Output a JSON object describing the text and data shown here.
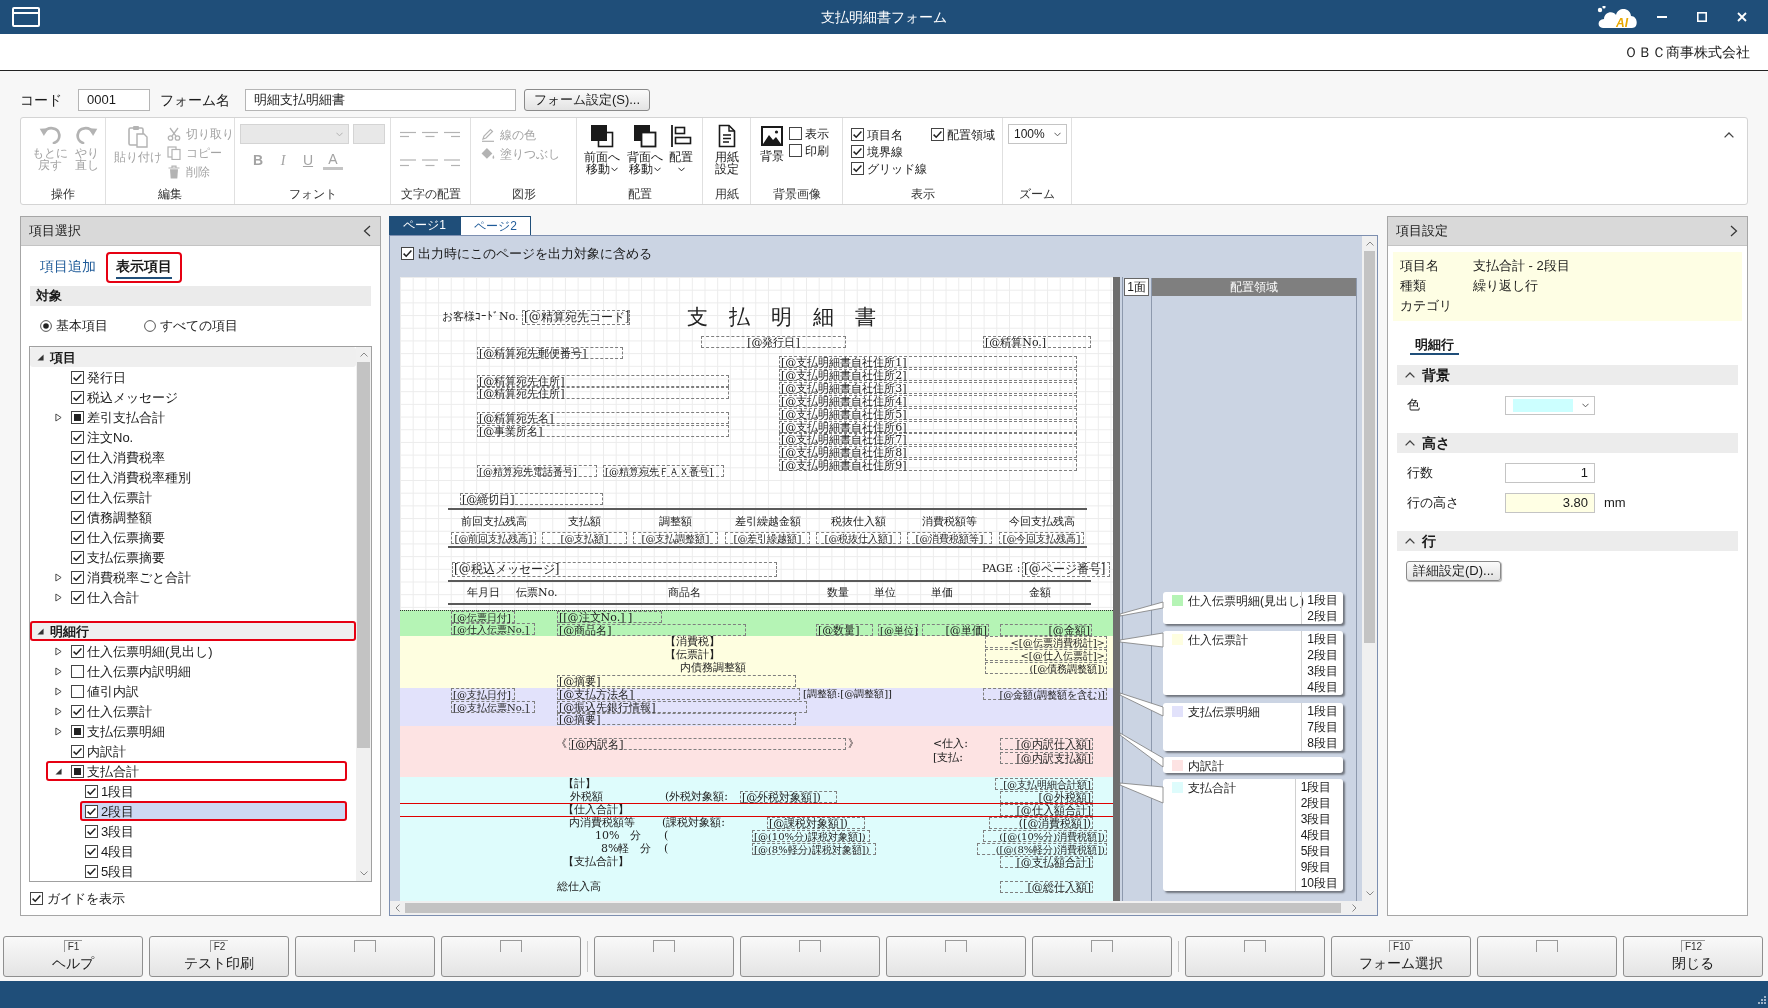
{
  "window": {
    "title": "支払明細書フォーム",
    "assistant_label": "AI"
  },
  "company": "ＯＢＣ商事株式会社",
  "form_header": {
    "code_label": "コード",
    "code": "0001",
    "name_label": "フォーム名",
    "name": "明細支払明細書",
    "settings_button": "フォーム設定(S)..."
  },
  "ribbon": {
    "groups": [
      {
        "label": "操作",
        "items": [
          {
            "kind": "large",
            "label": "もとに戻す",
            "menu": false,
            "disabled": true
          },
          {
            "kind": "large",
            "label": "やり直し",
            "menu": false,
            "disabled": true
          }
        ]
      },
      {
        "label": "編集",
        "items": [
          {
            "kind": "large",
            "label": "貼り付け",
            "menu": false,
            "disabled": true
          },
          {
            "kind": "small",
            "label": "切り取り",
            "disabled": true
          },
          {
            "kind": "small",
            "label": "コピー",
            "disabled": true
          },
          {
            "kind": "small",
            "label": "削除",
            "disabled": true
          }
        ]
      },
      {
        "label": "フォント",
        "items": [
          {
            "kind": "select",
            "disabled": true
          },
          {
            "kind": "field",
            "disabled": true
          },
          {
            "kind": "format",
            "label": "B",
            "disabled": true
          },
          {
            "kind": "format",
            "label": "I",
            "disabled": true
          },
          {
            "kind": "format",
            "label": "U",
            "disabled": true
          },
          {
            "kind": "format",
            "label": "A",
            "disabled": true
          }
        ]
      },
      {
        "label": "文字の配置",
        "items": [
          {
            "kind": "align",
            "disabled": true
          },
          {
            "kind": "align",
            "disabled": true
          },
          {
            "kind": "align",
            "disabled": true
          },
          {
            "kind": "align",
            "disabled": true
          },
          {
            "kind": "align",
            "disabled": true
          },
          {
            "kind": "align",
            "disabled": true
          }
        ]
      },
      {
        "label": "図形",
        "items": [
          {
            "kind": "small",
            "label": "線の色",
            "disabled": true
          },
          {
            "kind": "small",
            "label": "塗りつぶし",
            "disabled": true
          }
        ]
      },
      {
        "label": "配置",
        "items": [
          {
            "kind": "large",
            "label": "前面へ移動",
            "menu": true,
            "disabled": false
          },
          {
            "kind": "large",
            "label": "背面へ移動",
            "menu": true,
            "disabled": false
          },
          {
            "kind": "large",
            "label": "配置",
            "menu": true,
            "disabled": false
          }
        ]
      },
      {
        "label": "用紙",
        "items": [
          {
            "kind": "large",
            "label": "用紙設定",
            "menu": false,
            "disabled": false
          }
        ]
      },
      {
        "label": "背景画像",
        "items": [
          {
            "kind": "large",
            "label": "背景",
            "menu": false,
            "disabled": false
          },
          {
            "kind": "check",
            "label": "表示",
            "checked": false
          },
          {
            "kind": "check",
            "label": "印刷",
            "checked": false
          }
        ]
      },
      {
        "label": "表示",
        "items": [
          {
            "kind": "check",
            "label": "項目名",
            "checked": true
          },
          {
            "kind": "check",
            "label": "境界線",
            "checked": true
          },
          {
            "kind": "check",
            "label": "グリッド線",
            "checked": true
          },
          {
            "kind": "check",
            "label": "配置領域",
            "checked": true
          }
        ]
      },
      {
        "label": "ズーム",
        "items": [
          {
            "kind": "select",
            "value": "100%",
            "disabled": false
          }
        ]
      }
    ]
  },
  "item_panel": {
    "title": "項目選択",
    "tabs": [
      {
        "label": "項目追加",
        "selected": false,
        "annotated": false
      },
      {
        "label": "表示項目",
        "selected": true,
        "annotated": true
      }
    ],
    "target": {
      "heading": "対象",
      "options": [
        {
          "label": "基本項目",
          "selected": true
        },
        {
          "label": "すべての項目",
          "selected": false
        }
      ]
    },
    "tree": [
      {
        "label": "項目",
        "expanded": true,
        "selected": false,
        "annotated": false,
        "children": [
          {
            "label": "発行日",
            "checked": true,
            "indeterminate": false,
            "selected": false,
            "annotated": false
          },
          {
            "label": "税込メッセージ",
            "checked": true,
            "indeterminate": false,
            "selected": false,
            "annotated": false
          },
          {
            "label": "差引支払合計",
            "indeterminate": true,
            "expanded": false,
            "selected": false,
            "annotated": false
          },
          {
            "label": "注文No.",
            "checked": true,
            "indeterminate": false,
            "selected": false,
            "annotated": false
          },
          {
            "label": "仕入消費税率",
            "checked": true,
            "indeterminate": false,
            "selected": false,
            "annotated": false
          },
          {
            "label": "仕入消費税率種別",
            "checked": true,
            "indeterminate": false,
            "selected": false,
            "annotated": false
          },
          {
            "label": "仕入伝票計",
            "checked": true,
            "indeterminate": false,
            "selected": false,
            "annotated": false
          },
          {
            "label": "債務調整額",
            "checked": true,
            "indeterminate": false,
            "selected": false,
            "annotated": false
          },
          {
            "label": "仕入伝票摘要",
            "checked": true,
            "indeterminate": false,
            "selected": false,
            "annotated": false
          },
          {
            "label": "支払伝票摘要",
            "checked": true,
            "indeterminate": false,
            "selected": false,
            "annotated": false
          },
          {
            "label": "消費税率ごと合計",
            "checked": true,
            "indeterminate": false,
            "expanded": false,
            "selected": false,
            "annotated": false
          },
          {
            "label": "仕入合計",
            "checked": true,
            "indeterminate": false,
            "expanded": false,
            "selected": false,
            "annotated": false
          }
        ]
      },
      {
        "label": "明細行",
        "expanded": true,
        "selected": false,
        "annotated": true,
        "children": [
          {
            "label": "仕入伝票明細(見出し)",
            "checked": true,
            "indeterminate": false,
            "expanded": false,
            "selected": false,
            "annotated": false
          },
          {
            "label": "仕入伝票内訳明細",
            "checked": false,
            "indeterminate": false,
            "expanded": false,
            "selected": false,
            "annotated": false
          },
          {
            "label": "値引内訳",
            "checked": false,
            "indeterminate": false,
            "expanded": false,
            "selected": false,
            "annotated": false
          },
          {
            "label": "仕入伝票計",
            "checked": true,
            "indeterminate": false,
            "expanded": false,
            "selected": false,
            "annotated": false
          },
          {
            "label": "支払伝票明細",
            "indeterminate": true,
            "expanded": false,
            "selected": false,
            "annotated": false
          },
          {
            "label": "内訳計",
            "checked": true,
            "indeterminate": false,
            "selected": false,
            "annotated": false
          },
          {
            "label": "支払合計",
            "indeterminate": true,
            "expanded": true,
            "selected": false,
            "annotated": true,
            "children": [
              {
                "label": "1段目",
                "checked": true,
                "indeterminate": false,
                "selected": false,
                "annotated": false
              },
              {
                "label": "2段目",
                "checked": true,
                "indeterminate": false,
                "selected": true,
                "annotated": true
              },
              {
                "label": "3段目",
                "checked": true,
                "indeterminate": false,
                "selected": false,
                "annotated": false
              },
              {
                "label": "4段目",
                "checked": true,
                "indeterminate": false,
                "selected": false,
                "annotated": false
              },
              {
                "label": "5段目",
                "checked": true,
                "indeterminate": false,
                "selected": false,
                "annotated": false
              }
            ]
          }
        ]
      }
    ],
    "show_guide": {
      "label": "ガイドを表示",
      "checked": true
    }
  },
  "designer": {
    "tabs": [
      {
        "label": "ページ1",
        "selected": true
      },
      {
        "label": "ページ2",
        "selected": false
      }
    ],
    "include_page": {
      "label": "出力時にこのページを出力対象に含める",
      "checked": true
    },
    "paper": {
      "title": "支　払　明　細　書",
      "header": [
        {
          "kind": "label",
          "text": "お客様ｺｰﾄﾞNo."
        },
        {
          "kind": "field",
          "text": "[@精算宛先コード]"
        },
        {
          "kind": "field",
          "text": "[@発行日]"
        },
        {
          "kind": "field",
          "text": "[@精算No.]"
        },
        {
          "kind": "field",
          "text": "[@精算宛先郵便番号]"
        },
        {
          "kind": "field",
          "text": "[@精算宛先住所]"
        },
        {
          "kind": "field",
          "text": "[@精算宛先住所]"
        },
        {
          "kind": "field",
          "text": "[@精算宛先名]"
        },
        {
          "kind": "field",
          "text": "[@事業所名]"
        },
        {
          "kind": "field",
          "text": "[@精算宛先電話番号]"
        },
        {
          "kind": "field",
          "text": "[@精算宛先ＦＡＸ番号]"
        },
        {
          "kind": "field",
          "text": "[@支払明細書自社住所1]"
        },
        {
          "kind": "field",
          "text": "[@支払明細書自社住所2]"
        },
        {
          "kind": "field",
          "text": "[@支払明細書自社住所3]"
        },
        {
          "kind": "field",
          "text": "[@支払明細書自社住所4]"
        },
        {
          "kind": "field",
          "text": "[@支払明細書自社住所5]"
        },
        {
          "kind": "field",
          "text": "[@支払明細書自社住所6]"
        },
        {
          "kind": "field",
          "text": "[@支払明細書自社住所7]"
        },
        {
          "kind": "field",
          "text": "[@支払明細書自社住所8]"
        },
        {
          "kind": "field",
          "text": "[@支払明細書自社住所9]"
        },
        {
          "kind": "field",
          "text": "[@締切日]"
        },
        {
          "kind": "field",
          "text": "[@税込メッセージ]"
        },
        {
          "kind": "label",
          "text": "PAGE :"
        },
        {
          "kind": "field",
          "text": "[@ページ番号]"
        }
      ],
      "summary": [
        {
          "label": "前回支払残高",
          "value": "[@前回支払残高]"
        },
        {
          "label": "支払額",
          "value": "[@支払額]"
        },
        {
          "label": "調整額",
          "value": "[@支払調整額]"
        },
        {
          "label": "差引繰越金額",
          "value": "[@差引繰越額]"
        },
        {
          "label": "税抜仕入額",
          "value": "[@税抜仕入額]"
        },
        {
          "label": "消費税額等",
          "value": "[@消費税額等]"
        },
        {
          "label": "今回支払残高",
          "value": "[@今回支払残高]"
        }
      ],
      "columns": [
        "年月日",
        "伝票No.",
        "商品名",
        "数量",
        "単位",
        "単価",
        "金額"
      ],
      "bands": [
        {
          "color": "#b5f4b5",
          "fields": [
            {
              "kind": "field",
              "text": "[@伝票日付]"
            },
            {
              "kind": "field",
              "text": "[[@注文No.] ]"
            },
            {
              "kind": "field",
              "text": "[@仕入伝票No.]"
            },
            {
              "kind": "field",
              "text": "[@商品名]"
            },
            {
              "kind": "field",
              "text": "[@数量]"
            },
            {
              "kind": "field",
              "text": "[@単位]"
            },
            {
              "kind": "field",
              "text": "[@単価]"
            },
            {
              "kind": "field",
              "text": "[@金額]"
            }
          ]
        },
        {
          "color": "#fefee0",
          "fields": [
            {
              "kind": "label",
              "text": "【消費税】"
            },
            {
              "kind": "label",
              "text": "【伝票計】"
            },
            {
              "kind": "label",
              "text": "内債務調整額"
            },
            {
              "kind": "field",
              "text": "<[@伝票消費税計]>"
            },
            {
              "kind": "field",
              "text": "<[@仕入伝票計]>"
            },
            {
              "kind": "field",
              "text": "([@債務調整額])"
            },
            {
              "kind": "field",
              "text": "[@摘要]"
            }
          ]
        },
        {
          "color": "#e2e2fb",
          "fields": [
            {
              "kind": "field",
              "text": "[@支払日付]"
            },
            {
              "kind": "field",
              "text": "[@支払伝票No.]"
            },
            {
              "kind": "field",
              "text": "[@支払方法名]"
            },
            {
              "kind": "label",
              "text": "[調整額:[@調整額]]"
            },
            {
              "kind": "field",
              "text": "[@金額(調整額を含む)]"
            },
            {
              "kind": "field",
              "text": "[@振込先銀行情報]"
            },
            {
              "kind": "field",
              "text": "[@摘要]"
            }
          ]
        },
        {
          "color": "#fde3e3",
          "fields": [
            {
              "kind": "label",
              "text": "《"
            },
            {
              "kind": "field",
              "text": "[@内訳名]"
            },
            {
              "kind": "label",
              "text": "》"
            },
            {
              "kind": "label",
              "text": "<仕入:"
            },
            {
              "kind": "field",
              "text": "[@内訳仕入額]"
            },
            {
              "kind": "label",
              "text": "[支払:"
            },
            {
              "kind": "field",
              "text": "[@内訳支払額]"
            }
          ]
        },
        {
          "color": "#defcfc",
          "fields": [
            {
              "kind": "label",
              "text": "【計】"
            },
            {
              "kind": "field",
              "text": "[@支払明細合計額]"
            },
            {
              "kind": "label",
              "text": "外税額"
            },
            {
              "kind": "label",
              "text": "(外税対象額:"
            },
            {
              "kind": "field",
              "text": "[@外税対象額])"
            },
            {
              "kind": "field",
              "text": "[@外税額]"
            },
            {
              "kind": "label",
              "text": "【仕入合計】"
            },
            {
              "kind": "field",
              "text": "[@仕入額合計]"
            },
            {
              "kind": "label",
              "text": "内消費税額等"
            },
            {
              "kind": "label",
              "text": "(課税対象額:"
            },
            {
              "kind": "field",
              "text": "[@課税対象額])"
            },
            {
              "kind": "field",
              "text": "([@消費税額])"
            },
            {
              "kind": "label",
              "text": "10%　分"
            },
            {
              "kind": "label",
              "text": "("
            },
            {
              "kind": "field",
              "text": "[@(10%分)課税対象額])"
            },
            {
              "kind": "field",
              "text": "([@(10%分)消費税額])"
            },
            {
              "kind": "label",
              "text": "8%軽　分"
            },
            {
              "kind": "label",
              "text": "("
            },
            {
              "kind": "field",
              "text": "[@(8%軽分)課税対象額])"
            },
            {
              "kind": "field",
              "text": "([@(8%軽分)消費税額])"
            },
            {
              "kind": "label",
              "text": "【支払合計】"
            },
            {
              "kind": "field",
              "text": "[@支払額合計]"
            },
            {
              "kind": "label",
              "text": "総仕入高"
            },
            {
              "kind": "field",
              "text": "[@総仕入額]"
            }
          ]
        }
      ]
    },
    "page_marker": "1面",
    "area_heading": "配置領域",
    "callouts": [
      {
        "label": "仕入伝票明細(見出し)",
        "color": "#b5f4b5",
        "rows": [
          "1段目",
          "2段目"
        ]
      },
      {
        "label": "仕入伝票計",
        "color": "#fefee0",
        "rows": [
          "1段目",
          "2段目",
          "3段目",
          "4段目"
        ]
      },
      {
        "label": "支払伝票明細",
        "color": "#e2e2fb",
        "rows": [
          "1段目",
          "7段目",
          "8段目"
        ]
      },
      {
        "label": "内訳計",
        "color": "#fde3e3"
      },
      {
        "label": "支払合計",
        "color": "#defcfc",
        "rows": [
          "1段目",
          "2段目",
          "3段目",
          "4段目",
          "5段目",
          "9段目",
          "10段目"
        ]
      }
    ]
  },
  "settings_panel": {
    "title": "項目設定",
    "info": [
      {
        "label": "項目名",
        "value": "支払合計 - 2段目"
      },
      {
        "label": "種類",
        "value": "繰り返し行"
      },
      {
        "label": "カテゴリ"
      }
    ],
    "tabs": [
      {
        "label": "明細行",
        "selected": true
      }
    ],
    "sections": [
      {
        "title": "背景",
        "expanded": true,
        "rows": [
          {
            "kind": "color",
            "label": "色",
            "color": "#ccffff"
          }
        ]
      },
      {
        "title": "高さ",
        "expanded": true,
        "rows": [
          {
            "kind": "number",
            "label": "行数",
            "value": "1",
            "highlighted": false
          },
          {
            "kind": "number",
            "label": "行の高さ",
            "value": "3.80",
            "unit": "mm",
            "highlighted": true
          }
        ]
      },
      {
        "title": "行",
        "expanded": true,
        "rows": [
          {
            "kind": "button",
            "label": "詳細設定(D)..."
          }
        ]
      }
    ]
  },
  "function_keys": [
    {
      "kind": "assigned",
      "key": "F1",
      "label": "ヘルプ"
    },
    {
      "kind": "assigned",
      "key": "F2",
      "label": "テスト印刷"
    },
    {
      "kind": "blank"
    },
    {
      "kind": "blank"
    },
    {
      "kind": "blank"
    },
    {
      "kind": "blank"
    },
    {
      "kind": "blank"
    },
    {
      "kind": "blank"
    },
    {
      "kind": "blank"
    },
    {
      "kind": "assigned",
      "key": "F10",
      "label": "フォーム選択"
    },
    {
      "kind": "blank"
    },
    {
      "kind": "assigned",
      "key": "F12",
      "label": "閉じる"
    }
  ]
}
